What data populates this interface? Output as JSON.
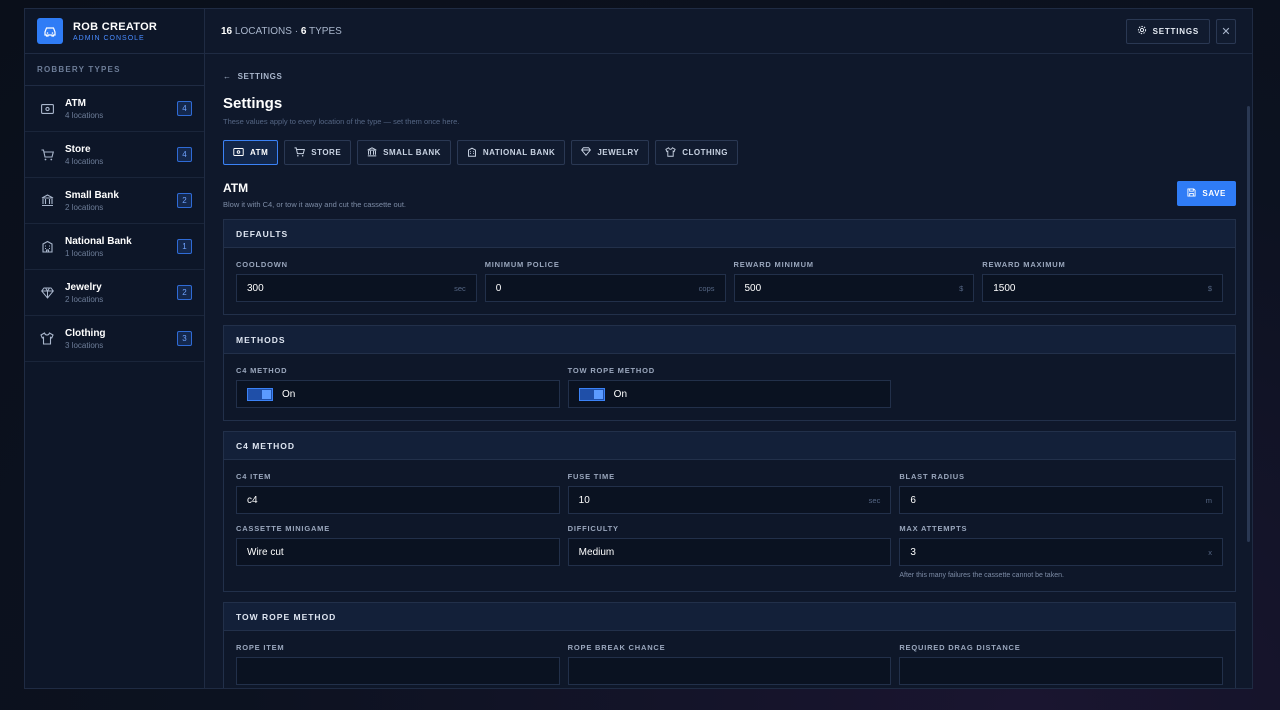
{
  "brand": {
    "title": "ROB CREATOR",
    "subtitle": "ADMIN CONSOLE"
  },
  "sidebar": {
    "heading": "ROBBERY TYPES",
    "items": [
      {
        "name": "ATM",
        "sub": "4 locations",
        "count": "4",
        "icon": "cash-icon"
      },
      {
        "name": "Store",
        "sub": "4 locations",
        "count": "4",
        "icon": "cart-icon"
      },
      {
        "name": "Small Bank",
        "sub": "2 locations",
        "count": "2",
        "icon": "bank-icon"
      },
      {
        "name": "National Bank",
        "sub": "1 locations",
        "count": "1",
        "icon": "building-icon"
      },
      {
        "name": "Jewelry",
        "sub": "2 locations",
        "count": "2",
        "icon": "diamond-icon"
      },
      {
        "name": "Clothing",
        "sub": "3 locations",
        "count": "3",
        "icon": "shirt-icon"
      }
    ]
  },
  "topbar": {
    "locations_count": "16",
    "locations_label": "LOCATIONS",
    "types_count": "6",
    "types_label": "TYPES",
    "settings_label": "SETTINGS",
    "close_glyph": "✕"
  },
  "page": {
    "back_label": "SETTINGS",
    "title": "Settings",
    "subtitle": "These values apply to every location of the type — set them once here."
  },
  "tabs": [
    "ATM",
    "STORE",
    "SMALL BANK",
    "NATIONAL BANK",
    "JEWELRY",
    "CLOTHING"
  ],
  "section": {
    "title": "ATM",
    "description": "Blow it with C4, or tow it away and cut the cassette out.",
    "save_label": "SAVE"
  },
  "defaults": {
    "heading": "DEFAULTS",
    "fields": [
      {
        "label": "COOLDOWN",
        "value": "300",
        "unit": "sec"
      },
      {
        "label": "MINIMUM POLICE",
        "value": "0",
        "unit": "cops"
      },
      {
        "label": "REWARD MINIMUM",
        "value": "500",
        "unit": "$"
      },
      {
        "label": "REWARD MAXIMUM",
        "value": "1500",
        "unit": "$"
      }
    ]
  },
  "methods": {
    "heading": "METHODS",
    "toggles": [
      {
        "label": "C4 METHOD",
        "state": "On"
      },
      {
        "label": "TOW ROPE METHOD",
        "state": "On"
      }
    ]
  },
  "c4_method": {
    "heading": "C4 METHOD",
    "fields": [
      {
        "label": "C4 ITEM",
        "value": "c4",
        "unit": ""
      },
      {
        "label": "FUSE TIME",
        "value": "10",
        "unit": "sec"
      },
      {
        "label": "BLAST RADIUS",
        "value": "6",
        "unit": "m"
      },
      {
        "label": "CASSETTE MINIGAME",
        "value": "Wire cut",
        "unit": ""
      },
      {
        "label": "DIFFICULTY",
        "value": "Medium",
        "unit": ""
      },
      {
        "label": "MAX ATTEMPTS",
        "value": "3",
        "unit": "x"
      }
    ],
    "hint": "After this many failures the cassette cannot be taken."
  },
  "tow_rope": {
    "heading": "TOW ROPE METHOD",
    "labels": [
      "ROPE ITEM",
      "ROPE BREAK CHANCE",
      "REQUIRED DRAG DISTANCE"
    ]
  },
  "colors": {
    "accent": "#2f7cf6",
    "background": "#0f182b"
  }
}
